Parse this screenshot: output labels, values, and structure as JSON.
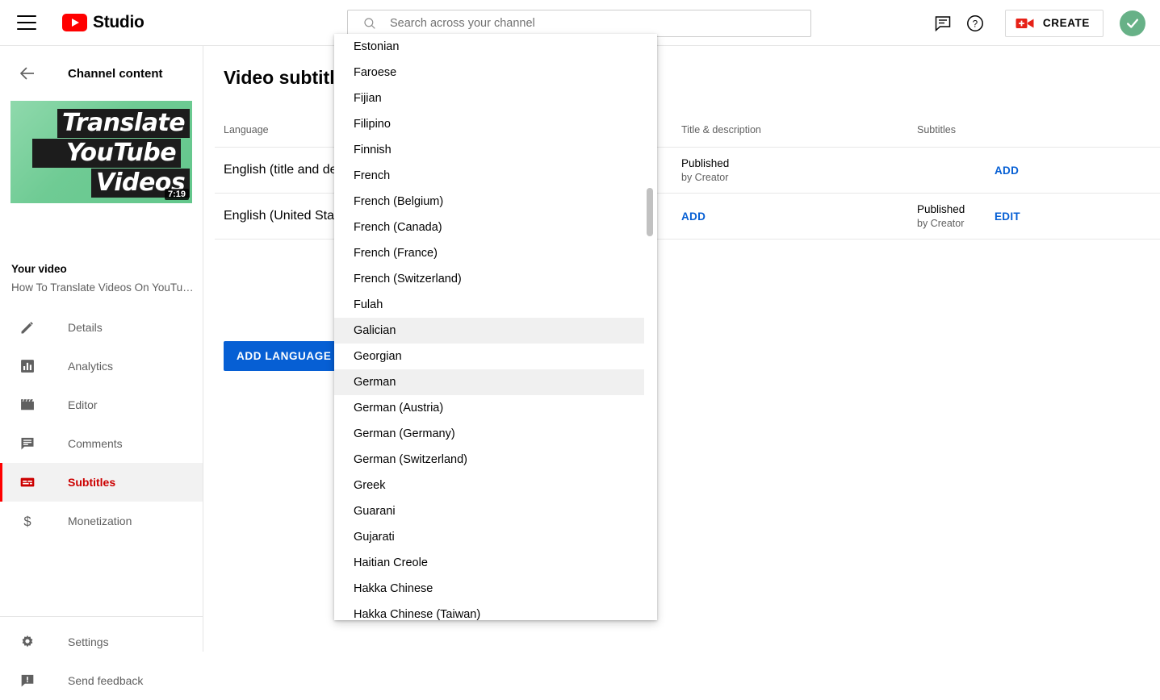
{
  "header": {
    "brand": "Studio",
    "search": {
      "placeholder": "Search across your channel",
      "value": ""
    },
    "create_label": "CREATE",
    "icons": {
      "menu": "hamburger-menu-icon",
      "feedback": "comment-icon",
      "help": "help-circle-icon",
      "camera": "video-camera-icon",
      "avatar": "green-check-avatar"
    }
  },
  "sidebar": {
    "back_label": "Channel content",
    "thumbnail": {
      "line1": "Translate",
      "line2": "YouTube",
      "line3": "Videos",
      "duration": "7:19"
    },
    "your_video_label": "Your video",
    "video_title": "How To Translate Videos On YouTub…",
    "items": [
      {
        "label": "Details",
        "icon": "pencil-icon",
        "active": false
      },
      {
        "label": "Analytics",
        "icon": "bar-chart-icon",
        "active": false
      },
      {
        "label": "Editor",
        "icon": "clapperboard-icon",
        "active": false
      },
      {
        "label": "Comments",
        "icon": "comment-lines-icon",
        "active": false
      },
      {
        "label": "Subtitles",
        "icon": "subtitles-icon",
        "active": true
      },
      {
        "label": "Monetization",
        "icon": "dollar-sign-icon",
        "active": false
      }
    ],
    "bottom_items": [
      {
        "label": "Settings",
        "icon": "gear-icon"
      },
      {
        "label": "Send feedback",
        "icon": "feedback-icon"
      }
    ]
  },
  "main": {
    "page_title": "Video subtitles",
    "add_language_label": "ADD LANGUAGE",
    "table": {
      "columns": [
        "Language",
        "Title & description",
        "Subtitles"
      ],
      "rows": [
        {
          "language": "English (title and description)",
          "title_status": "Published",
          "title_by": "by Creator",
          "title_action": "",
          "subs_status": "",
          "subs_by": "",
          "subs_action": "ADD"
        },
        {
          "language": "English (United States) (video language)",
          "title_status": "",
          "title_by": "",
          "title_action": "ADD",
          "subs_status": "Published",
          "subs_by": "by Creator",
          "subs_action": "EDIT"
        }
      ]
    }
  },
  "dropdown": {
    "name": "language-select-dropdown",
    "items": [
      {
        "label": "Estonian",
        "highlighted": false
      },
      {
        "label": "Faroese",
        "highlighted": false
      },
      {
        "label": "Fijian",
        "highlighted": false
      },
      {
        "label": "Filipino",
        "highlighted": false
      },
      {
        "label": "Finnish",
        "highlighted": false
      },
      {
        "label": "French",
        "highlighted": false
      },
      {
        "label": "French (Belgium)",
        "highlighted": false
      },
      {
        "label": "French (Canada)",
        "highlighted": false
      },
      {
        "label": "French (France)",
        "highlighted": false
      },
      {
        "label": "French (Switzerland)",
        "highlighted": false
      },
      {
        "label": "Fulah",
        "highlighted": false
      },
      {
        "label": "Galician",
        "highlighted": true
      },
      {
        "label": "Georgian",
        "highlighted": false
      },
      {
        "label": "German",
        "highlighted": true
      },
      {
        "label": "German (Austria)",
        "highlighted": false
      },
      {
        "label": "German (Germany)",
        "highlighted": false
      },
      {
        "label": "German (Switzerland)",
        "highlighted": false
      },
      {
        "label": "Greek",
        "highlighted": false
      },
      {
        "label": "Guarani",
        "highlighted": false
      },
      {
        "label": "Gujarati",
        "highlighted": false
      },
      {
        "label": "Haitian Creole",
        "highlighted": false
      },
      {
        "label": "Hakka Chinese",
        "highlighted": false
      },
      {
        "label": "Hakka Chinese (Taiwan)",
        "highlighted": false
      }
    ]
  },
  "colors": {
    "brand_red": "#ff0000",
    "link_blue": "#065fd4",
    "active_red": "#cc0000",
    "avatar_green": "#67b187",
    "highlight_gray": "#f0f0f0"
  }
}
